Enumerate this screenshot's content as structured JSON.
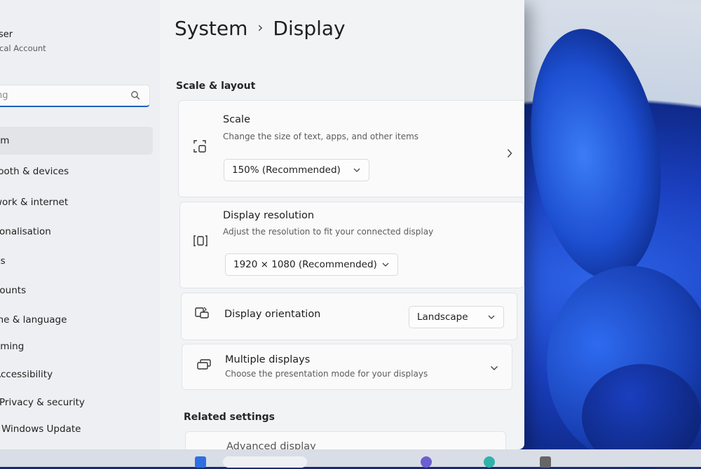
{
  "sidebar": {
    "user_name": "ser",
    "user_type": "ocal Account",
    "search_placeholder": "ng",
    "items": [
      {
        "label": "em"
      },
      {
        "label": "tooth & devices"
      },
      {
        "label": "work & internet"
      },
      {
        "label": "sonalisation"
      },
      {
        "label": "ps"
      },
      {
        "label": "counts"
      },
      {
        "label": "me & language"
      },
      {
        "label": "aming"
      },
      {
        "label": "Accessibility"
      },
      {
        "label": "Privacy & security"
      },
      {
        "label": "Windows Update"
      }
    ]
  },
  "header": {
    "breadcrumb_parent": "System",
    "breadcrumb_separator": "›",
    "breadcrumb_current": "Display"
  },
  "sections": {
    "scale_layout": "Scale & layout",
    "related": "Related settings"
  },
  "cards": {
    "scale": {
      "title": "Scale",
      "subtitle": "Change the size of text, apps, and other items",
      "value": "150% (Recommended)"
    },
    "resolution": {
      "title": "Display resolution",
      "subtitle": "Adjust the resolution to fit your connected display",
      "value": "1920 × 1080 (Recommended)"
    },
    "orientation": {
      "title": "Display orientation",
      "value": "Landscape"
    },
    "multiple": {
      "title": "Multiple displays",
      "subtitle": "Choose the presentation mode for your displays"
    },
    "advanced": {
      "title": "Advanced display"
    }
  },
  "colors": {
    "accent": "#1f5fbf",
    "window_bg": "#f2f3f5",
    "card_bg": "#fafafb"
  }
}
